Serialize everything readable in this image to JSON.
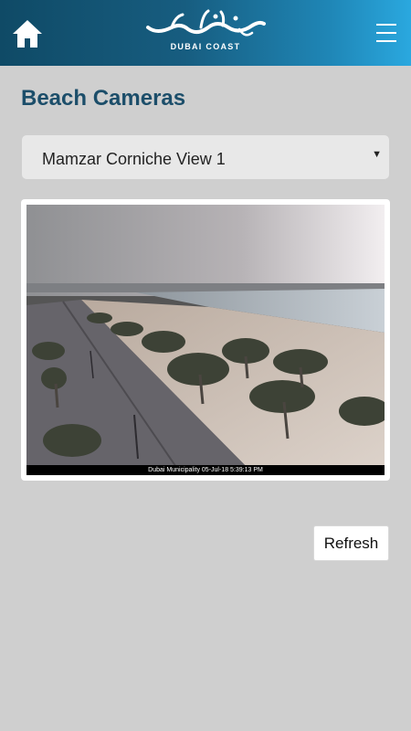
{
  "header": {
    "home_icon": "home-icon",
    "logo_subtitle": "DUBAI COAST",
    "menu_icon": "hamburger-menu-icon",
    "gradient_colors": [
      "#0f4a66",
      "#2aa8df"
    ]
  },
  "main": {
    "title": "Beach Cameras",
    "title_color": "#1c4e6a",
    "camera_select": {
      "selected": "Mamzar Corniche View 1"
    },
    "camera_feed": {
      "timestamp_overlay": "Dubai Municipality 05-Jul-18 5:39:13 PM"
    },
    "refresh_label": "Refresh"
  }
}
